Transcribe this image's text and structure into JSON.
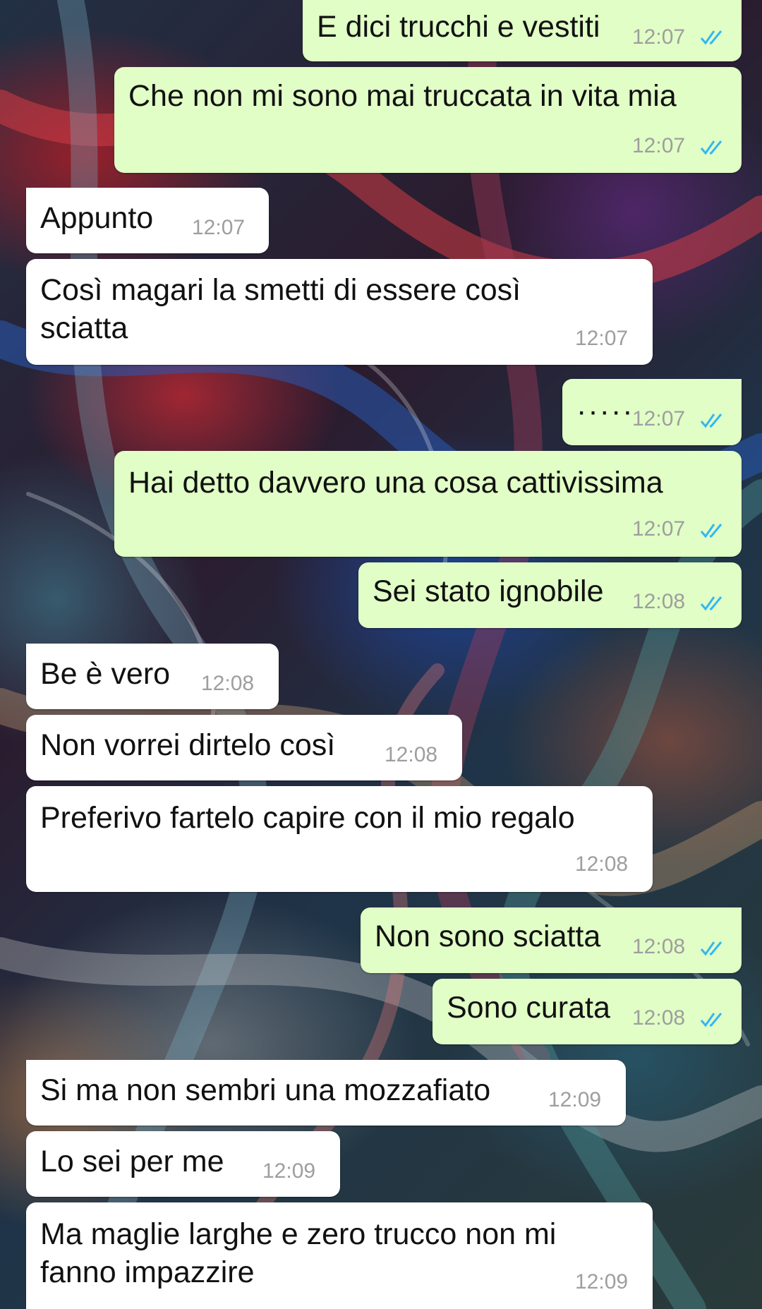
{
  "messages": [
    {
      "side": "out",
      "text": "E dici trucchi e vestiti",
      "time": "12:07",
      "read": true
    },
    {
      "side": "out",
      "text": "Che non mi sono mai truccata in vita mia",
      "time": "12:07",
      "read": true
    },
    {
      "side": "in",
      "text": "Appunto",
      "time": "12:07"
    },
    {
      "side": "in",
      "text_line1": "Così magari la smetti di essere così",
      "text_line2": "sciatta",
      "time": "12:07"
    },
    {
      "side": "out",
      "text": "·····",
      "time": "12:07",
      "read": true
    },
    {
      "side": "out",
      "text": "Hai detto davvero una cosa cattivissima",
      "time": "12:07",
      "read": true
    },
    {
      "side": "out",
      "text": "Sei stato ignobile",
      "time": "12:08",
      "read": true
    },
    {
      "side": "in",
      "text": "Be è vero",
      "time": "12:08"
    },
    {
      "side": "in",
      "text": "Non vorrei dirtelo così",
      "time": "12:08"
    },
    {
      "side": "in",
      "text": "Preferivo fartelo capire con il mio regalo",
      "time": "12:08"
    },
    {
      "side": "out",
      "text": "Non sono sciatta",
      "time": "12:08",
      "read": true
    },
    {
      "side": "out",
      "text": "Sono curata",
      "time": "12:08",
      "read": true
    },
    {
      "side": "in",
      "text": "Si ma non sembri una mozzafiato",
      "time": "12:09"
    },
    {
      "side": "in",
      "text": "Lo sei per me",
      "time": "12:09"
    },
    {
      "side": "in",
      "text_line1": "Ma maglie larghe e zero trucco non mi",
      "text_line2": "fanno impazzire",
      "time": "12:09"
    }
  ],
  "colors": {
    "outgoing_bubble": "#e1fec6",
    "incoming_bubble": "#ffffff",
    "read_ticks": "#34b7f1",
    "time_text": "#9e9e9e"
  },
  "icons": {
    "read_receipt": "double-check-icon"
  }
}
